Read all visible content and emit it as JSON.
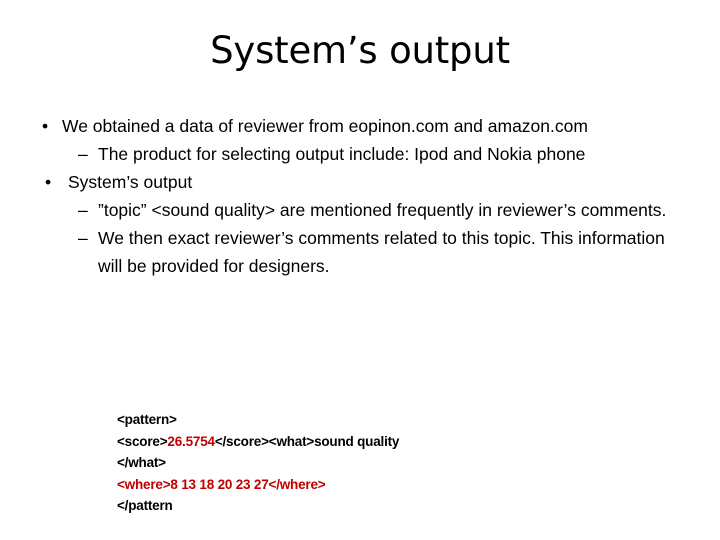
{
  "slide": {
    "title": "System’s output",
    "background_color": "#FFFFFF",
    "text_color": "#000000",
    "accent_color": "#C00000"
  },
  "bullets": {
    "level1_marker": "•",
    "level2_marker": "–",
    "items": [
      {
        "level": 1,
        "text": "We obtained a data of reviewer from eopinon.com and amazon.com"
      },
      {
        "level": 2,
        "text": "The product for selecting output include: Ipod and Nokia phone"
      },
      {
        "level": 1,
        "text": "System’s output"
      },
      {
        "level": 2,
        "text": "”topic”   <sound quality> are mentioned frequently in reviewer’s comments."
      },
      {
        "level": 2,
        "text": "We  then exact reviewer’s comments related to this topic. This information will be provided for designers."
      }
    ]
  },
  "pattern_block": {
    "lines": [
      {
        "segments": [
          {
            "text": "<pattern>",
            "color": "black"
          }
        ]
      },
      {
        "segments": [
          {
            "text": "<score>",
            "color": "black"
          },
          {
            "text": "26.5754",
            "color": "red"
          },
          {
            "text": "</score><what>sound quality </what>",
            "color": "black"
          }
        ]
      },
      {
        "segments": [
          {
            "text": "<where>8 13 18 20 23 27</where>",
            "color": "red"
          }
        ]
      },
      {
        "segments": [
          {
            "text": "</pattern",
            "color": "black"
          }
        ]
      }
    ],
    "plain_text": "<pattern>\n<score>26.5754</score><what>sound quality </what>\n<where>8 13 18 20 23 27</where>\n</pattern",
    "score_value": "26.5754",
    "what_value": "sound quality",
    "where_values": "8 13 18 20 23 27"
  }
}
